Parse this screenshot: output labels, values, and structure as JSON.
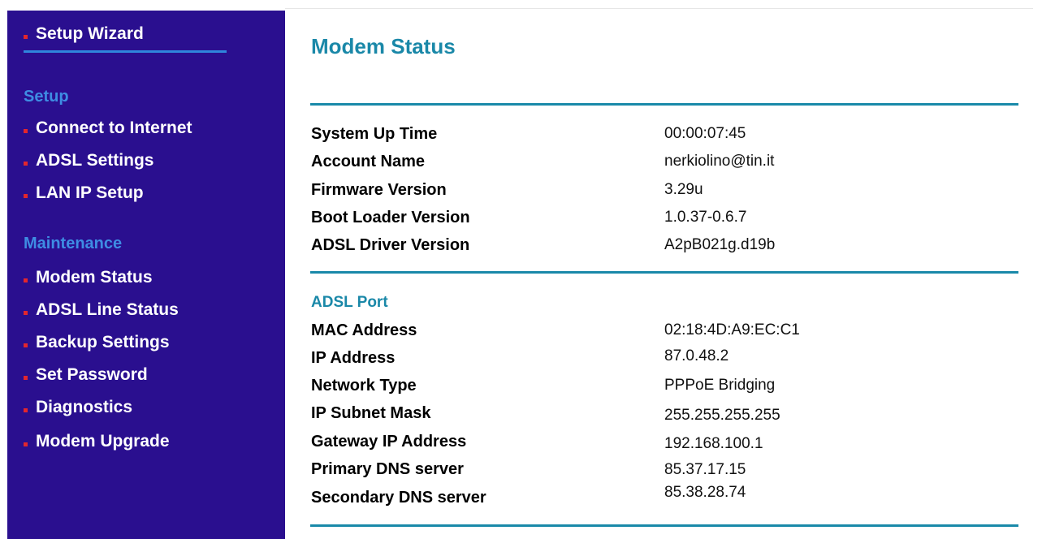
{
  "sidebar": {
    "setup_wizard": "Setup Wizard",
    "setup_heading": "Setup",
    "setup_items": [
      "Connect to Internet",
      "ADSL Settings",
      "LAN IP Setup"
    ],
    "maintenance_heading": "Maintenance",
    "maintenance_items": [
      "Modem Status",
      "ADSL Line Status",
      "Backup Settings",
      "Set Password",
      "Diagnostics",
      "Modem Upgrade"
    ],
    "colors": {
      "background": "#2a0f8f",
      "heading": "#3e8de3",
      "bullet": "#e3262d"
    }
  },
  "main": {
    "title": "Modem Status",
    "system": {
      "system_up_time_label": "System Up Time",
      "system_up_time": "00:00:07:45",
      "account_name_label": "Account Name",
      "account_name": "nerkiolino@tin.it",
      "firmware_version_label": "Firmware Version",
      "firmware_version": "3.29u",
      "boot_loader_version_label": "Boot Loader Version",
      "boot_loader_version": "1.0.37-0.6.7",
      "adsl_driver_version_label": "ADSL Driver Version",
      "adsl_driver_version": "A2pB021g.d19b"
    },
    "adsl_port": {
      "heading": "ADSL Port",
      "mac_address_label": "MAC Address",
      "mac_address": "02:18:4D:A9:EC:C1",
      "ip_address_label": "IP Address",
      "ip_address": "87.0.48.2",
      "network_type_label": "Network Type",
      "network_type": "PPPoE Bridging",
      "ip_subnet_mask_label": "IP Subnet Mask",
      "ip_subnet_mask": "255.255.255.255",
      "gateway_ip_address_label": "Gateway IP Address",
      "gateway_ip_address": "192.168.100.1",
      "primary_dns_label": "Primary DNS server",
      "primary_dns": "85.37.17.15",
      "secondary_dns_label": "Secondary DNS server",
      "secondary_dns": "85.38.28.74"
    },
    "colors": {
      "accent": "#1a88a8",
      "rule": "#1989a9"
    }
  }
}
